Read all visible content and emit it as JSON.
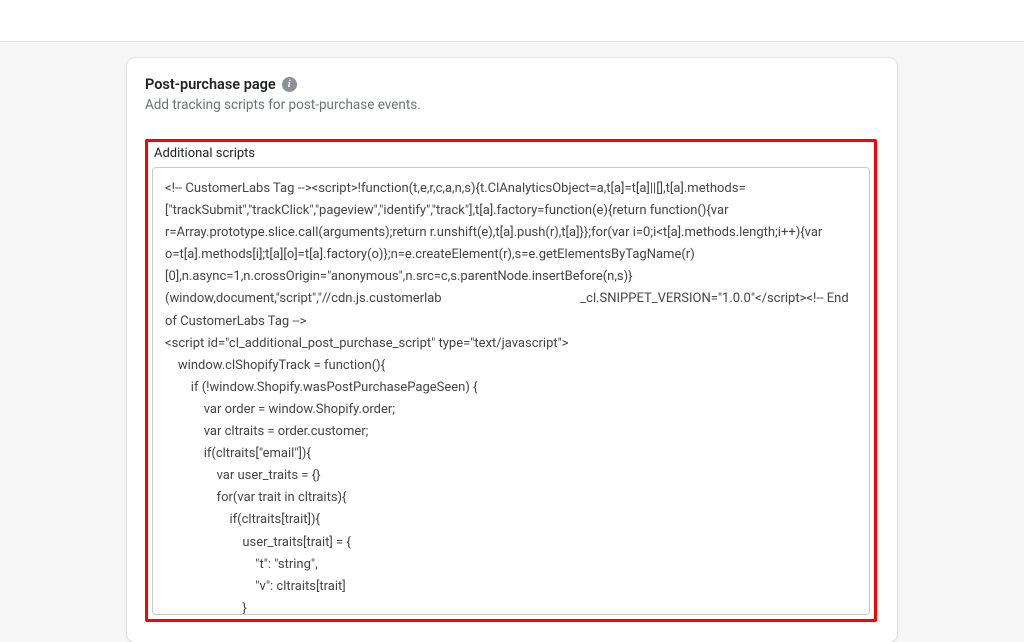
{
  "card": {
    "title": "Post-purchase page",
    "subtitle": "Add tracking scripts for post-purchase events."
  },
  "field": {
    "label": "Additional scripts",
    "value": "<!-- CustomerLabs Tag --><script>!function(t,e,r,c,a,n,s){t.ClAnalyticsObject=a,t[a]=t[a]||[],t[a].methods=[\"trackSubmit\",\"trackClick\",\"pageview\",\"identify\",\"track\"],t[a].factory=function(e){return function(){var r=Array.prototype.slice.call(arguments);return r.unshift(e),t[a].push(r),t[a]}};for(var i=0;i<t[a].methods.length;i++){var o=t[a].methods[i];t[a][o]=t[a].factory(o)};n=e.createElement(r),s=e.getElementsByTagName(r)[0],n.async=1,n.crossOrigin=\"anonymous\",n.src=c,s.parentNode.insertBefore(n,s)}(window,document,\"script\",\"//cdn.js.customerlab                                           _cl.SNIPPET_VERSION=\"1.0.0\"</script><!-- End of CustomerLabs Tag -->\n<script id=\"cl_additional_post_purchase_script\" type=\"text/javascript\">\n    window.clShopifyTrack = function(){\n        if (!window.Shopify.wasPostPurchasePageSeen) {\n            var order = window.Shopify.order;\n            var cltraits = order.customer;\n            if(cltraits[\"email\"]){\n                var user_traits = {}\n                for(var trait in cltraits){\n                    if(cltraits[trait]){\n                        user_traits[trait] = {\n                            \"t\": \"string\",\n                            \"v\": cltraits[trait]\n                        }"
  }
}
